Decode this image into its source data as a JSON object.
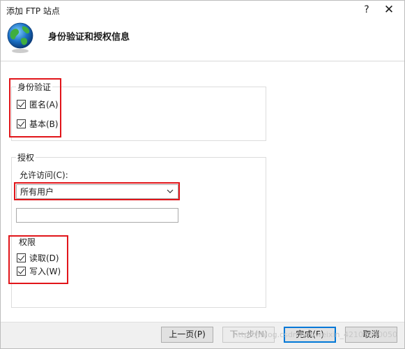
{
  "window": {
    "title": "添加 FTP 站点",
    "help_glyph": "?",
    "close_glyph": "✕"
  },
  "header": {
    "heading": "身份验证和授权信息",
    "icon": "globe-icon"
  },
  "authentication": {
    "legend": "身份验证",
    "anonymous_label": "匿名(A)",
    "anonymous_checked": true,
    "basic_label": "基本(B)",
    "basic_checked": true
  },
  "authorization": {
    "legend": "授权",
    "allow_access_label": "允许访问(C):",
    "allow_access_value": "所有用户",
    "extra_field_value": "",
    "permissions_legend": "权限",
    "read_label": "读取(D)",
    "read_checked": true,
    "write_label": "写入(W)",
    "write_checked": true
  },
  "footer": {
    "prev_label": "上一页(P)",
    "next_label": "下一步(N)",
    "finish_label": "完成(F)",
    "cancel_label": "取消"
  },
  "watermark": "https://blog.csdn.net/weixin_42101080050",
  "colors": {
    "highlight": "#e1151a",
    "default_button_border": "#0078d7"
  }
}
